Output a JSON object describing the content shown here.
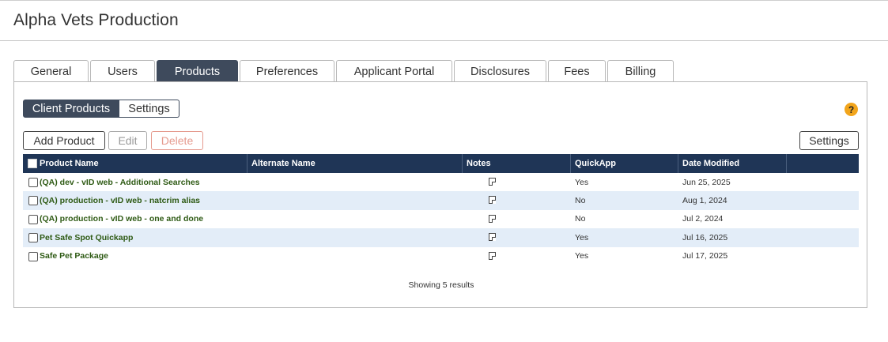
{
  "page": {
    "title": "Alpha Vets Production"
  },
  "tabs": [
    {
      "label": "General",
      "active": false
    },
    {
      "label": "Users",
      "active": false
    },
    {
      "label": "Products",
      "active": true
    },
    {
      "label": "Preferences",
      "active": false
    },
    {
      "label": "Applicant Portal",
      "active": false
    },
    {
      "label": "Disclosures",
      "active": false
    },
    {
      "label": "Fees",
      "active": false
    },
    {
      "label": "Billing",
      "active": false
    }
  ],
  "subtabs": {
    "client_products": "Client Products",
    "settings": "Settings"
  },
  "help": {
    "icon": "question-circle-icon",
    "glyph": "?",
    "color": "#f2a51c"
  },
  "toolbar": {
    "add_label": "Add Product",
    "edit_label": "Edit",
    "delete_label": "Delete",
    "settings_label": "Settings"
  },
  "table": {
    "headers": [
      "Product Name",
      "Alternate Name",
      "Notes",
      "QuickApp",
      "Date Modified"
    ],
    "rows": [
      {
        "name": "(QA) dev - vID web - Additional Searches",
        "alternate": "",
        "quickapp": "Yes",
        "date": "Jun 25, 2025"
      },
      {
        "name": "(QA) production - vID web - natcrim alias",
        "alternate": "",
        "quickapp": "No",
        "date": "Aug 1, 2024"
      },
      {
        "name": "(QA) production - vID web - one and done",
        "alternate": "",
        "quickapp": "No",
        "date": "Jul 2, 2024"
      },
      {
        "name": "Pet Safe Spot Quickapp",
        "alternate": "",
        "quickapp": "Yes",
        "date": "Jul 16, 2025"
      },
      {
        "name": "Safe Pet Package",
        "alternate": "",
        "quickapp": "Yes",
        "date": "Jul 17, 2025"
      }
    ]
  },
  "footer": {
    "results": "Showing 5 results"
  },
  "colors": {
    "header_bg": "#1f3556",
    "active_tab": "#3e4a5c",
    "row_alt": "#e3edf8",
    "product_link": "#2e5a14",
    "delete": "#e59a8e"
  }
}
